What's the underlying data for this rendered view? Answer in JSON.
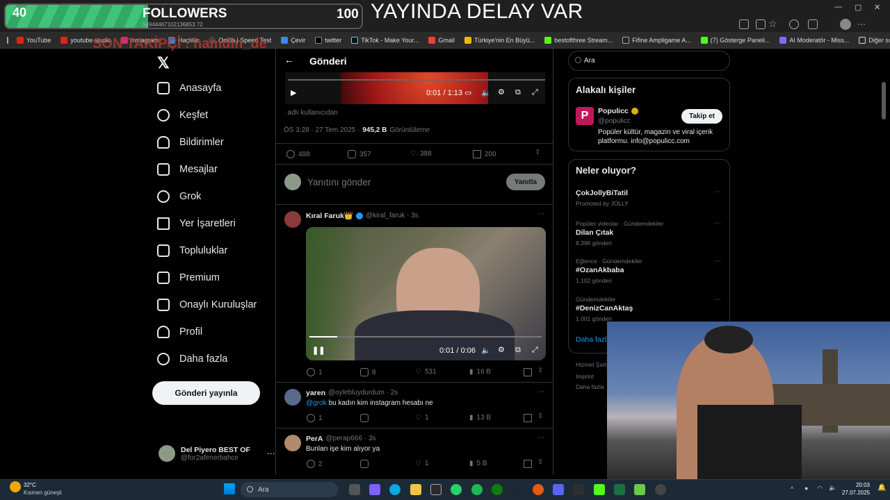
{
  "overlay": {
    "followers_current": "40",
    "followers_label": "FOLLOWERS",
    "followers_goal": "100",
    "followers_progress": 0.4,
    "sub_id": "94944467102136853 72",
    "stream_title": "YAYINDA DELAY VAR",
    "last_follower": "SON TAKİPÇİ : hamdin_de"
  },
  "bookmarks": [
    "YouTube",
    "youtube studio",
    "Instagram",
    "Haçlılar",
    "Ookla | Speed Test",
    "Çevir",
    "twitter",
    "TikTok - Make Your...",
    "Gmail",
    "Türkiye'nin En Büyü...",
    "bestofthree Stream...",
    "Fifine Ampligame A...",
    "(7) Gösterge Paneli...",
    "AI Moderatör - Miss...",
    "Diğer sık kullanılanlar"
  ],
  "nav": {
    "items": [
      "Anasayfa",
      "Keşfet",
      "Bildirimler",
      "Mesajlar",
      "Grok",
      "Yer İşaretleri",
      "Topluluklar",
      "Premium",
      "Onaylı Kuruluşlar",
      "Profil",
      "Daha fazla"
    ],
    "post_button": "Gönderi yayınla",
    "account_name": "Del Piyero BEST OF",
    "account_handle": "@for2afenerbahce"
  },
  "post": {
    "header": "Gönderi",
    "video_time": "0:01 / 1:13",
    "caption": ". adlı kullanıcıdan",
    "timestamp": "ÖS 3:28 · 27 Tem 2025 ·",
    "views": "945,2 B",
    "views_label": "Görüntüleme",
    "replies": "488",
    "reposts": "357",
    "likes": "388",
    "bookmarks": "200",
    "reply_placeholder": "Yanıtını gönder",
    "reply_button": "Yanıtla"
  },
  "replies": [
    {
      "name": "Kıral Faruk👑",
      "handle": "@kiral_faruk · 3s",
      "text": "",
      "video_time": "0:01 / 0:06",
      "replies": "1",
      "reposts": "8",
      "likes": "531",
      "views": "16 B"
    },
    {
      "name": "yaren",
      "handle": "@oylebluydurdum · 2s",
      "mention": "@grok",
      "text": "bu kadın kim instagram hesabı ne",
      "replies": "1",
      "reposts": "",
      "likes": "1",
      "views": "13 B"
    },
    {
      "name": "PerA",
      "handle": "@perap666 · 3s",
      "text": "Bunları işe kim alıyor ya",
      "replies": "2",
      "reposts": "",
      "likes": "1",
      "views": "5 B"
    }
  ],
  "right": {
    "search_placeholder": "Ara",
    "related_title": "Alakalı kişiler",
    "related_name": "Populicc",
    "related_handle": "@populicc",
    "related_bio": "Popüler kültür, magazin ve viral içerik platformu. info@populicc.com",
    "follow_button": "Takip et",
    "trends_title": "Neler oluyor?",
    "trends": [
      {
        "category": "",
        "name": "ÇokJollyBiTatil",
        "count": "Promoted by JOLLY"
      },
      {
        "category": "Popüler videolar · Gündemdekiler",
        "name": "Dilan Çıtak",
        "count": "8.396 gönderi"
      },
      {
        "category": "Eğlence · Gündemdekiler",
        "name": "#OzanAkbaba",
        "count": "1.102 gönderi"
      },
      {
        "category": "Gündemdekiler",
        "name": "#DenizCanAktaş",
        "count": "1.001 gönderi"
      }
    ],
    "show_more": "Daha fazla",
    "footer": [
      "Hizmet Şartla",
      "Imprint",
      "Daha fazla"
    ]
  },
  "taskbar": {
    "weather_temp": "32°C",
    "weather_desc": "Kısmen güneşli",
    "search": "Ara",
    "time": "20:03",
    "date": "27.07.2025"
  }
}
